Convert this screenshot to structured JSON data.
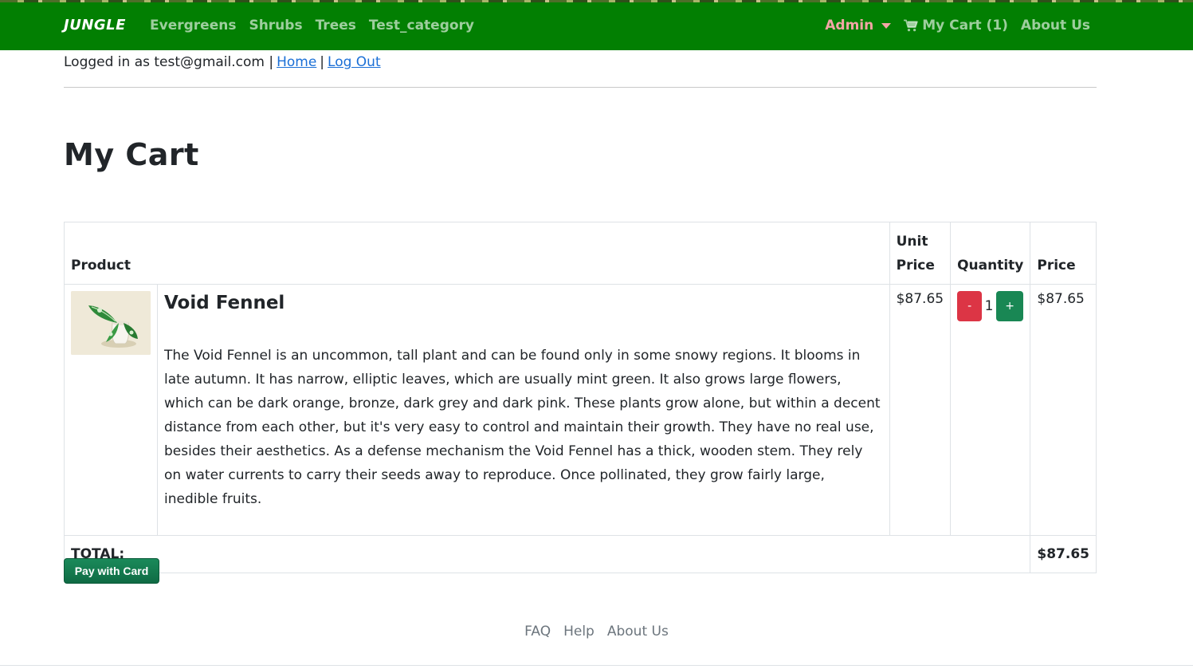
{
  "navbar": {
    "brand": "JUNGLE",
    "categories": [
      "Evergreens",
      "Shrubs",
      "Trees",
      "Test_category"
    ],
    "admin_label": "Admin",
    "cart_label": "My Cart (1)",
    "about_label": "About Us",
    "cart_icon": "shopping-cart-icon",
    "colors": {
      "background": "#027f02",
      "admin": "#f4a6a6"
    }
  },
  "session": {
    "logged_in_text": "Logged in as test@gmail.com |",
    "home_link": "Home",
    "separator": "|",
    "logout_link": "Log Out"
  },
  "page": {
    "title": "My Cart"
  },
  "table": {
    "headers": {
      "product": "Product",
      "unit_price": "Unit Price",
      "quantity": "Quantity",
      "price": "Price"
    },
    "items": [
      {
        "name": "Void Fennel",
        "description": "The Void Fennel is an uncommon, tall plant and can be found only in some snowy regions. It blooms in late autumn. It has narrow, elliptic leaves, which are usually mint green. It also grows large flowers, which can be dark orange, bronze, dark grey and dark pink. These plants grow alone, but within a decent distance from each other, but it's very easy to control and maintain their growth. They have no real use, besides their aesthetics. As a defense mechanism the Void Fennel has a thick, wooden stem. They rely on water currents to carry their seeds away to reproduce. Once pollinated, they grow fairly large, inedible fruits.",
        "unit_price": "$87.65",
        "quantity": "1",
        "price": "$87.65",
        "minus_label": "-",
        "plus_label": "+"
      }
    ],
    "total_label": "TOTAL:",
    "total_value": "$87.65"
  },
  "pay_button": "Pay with Card",
  "footer": {
    "links": [
      "FAQ",
      "Help",
      "About Us"
    ]
  }
}
